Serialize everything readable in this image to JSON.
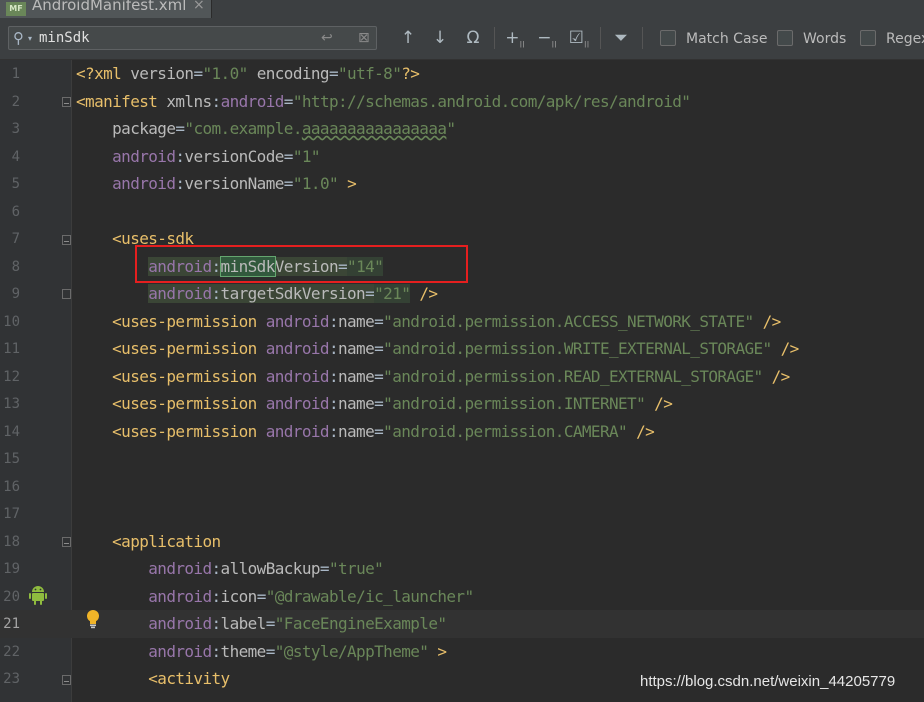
{
  "tab": {
    "icon_text": "MF",
    "label": "AndroidManifest.xml",
    "close": "×"
  },
  "find": {
    "query": "minSdk",
    "options": [
      {
        "label": "Match Case"
      },
      {
        "label": "Words"
      },
      {
        "label": "Regex"
      }
    ]
  },
  "editor": {
    "current_line": 21,
    "line_numbers": [
      "1",
      "2",
      "3",
      "4",
      "5",
      "6",
      "7",
      "8",
      "9",
      "10",
      "11",
      "12",
      "13",
      "14",
      "15",
      "16",
      "17",
      "18",
      "19",
      "20",
      "21",
      "22",
      "23"
    ],
    "lines": [
      [
        [
          "t-tag",
          "<?xml "
        ],
        [
          "t-attr",
          "version"
        ],
        [
          "t-plain",
          "="
        ],
        [
          "t-val",
          "\"1.0\""
        ],
        [
          "t-plain",
          " "
        ],
        [
          "t-attr",
          "encoding"
        ],
        [
          "t-plain",
          "="
        ],
        [
          "t-val",
          "\"utf-8\""
        ],
        [
          "t-tag",
          "?>"
        ]
      ],
      [
        [
          "t-tag",
          "<manifest "
        ],
        [
          "t-attr",
          "xmlns"
        ],
        [
          "t-plain",
          ":"
        ],
        [
          "t-ns",
          "android"
        ],
        [
          "t-plain",
          "="
        ],
        [
          "t-val",
          "\"http://schemas.android.com/apk/res/android\""
        ]
      ],
      [
        [
          "t-plain",
          "    "
        ],
        [
          "t-attr",
          "package"
        ],
        [
          "t-plain",
          "="
        ],
        [
          "t-val",
          "\"com.example."
        ],
        [
          "t-val t-sq",
          "aaaaaaaaaaaaaaaa"
        ],
        [
          "t-val",
          "\""
        ]
      ],
      [
        [
          "t-plain",
          "    "
        ],
        [
          "t-ns",
          "android"
        ],
        [
          "t-plain",
          ":"
        ],
        [
          "t-attr",
          "versionCode"
        ],
        [
          "t-plain",
          "="
        ],
        [
          "t-val",
          "\"1\""
        ]
      ],
      [
        [
          "t-plain",
          "    "
        ],
        [
          "t-ns",
          "android"
        ],
        [
          "t-plain",
          ":"
        ],
        [
          "t-attr",
          "versionName"
        ],
        [
          "t-plain",
          "="
        ],
        [
          "t-val",
          "\"1.0\""
        ],
        [
          "t-plain",
          " "
        ],
        [
          "t-tag",
          ">"
        ]
      ],
      [],
      [
        [
          "t-plain",
          "    "
        ],
        [
          "t-tag",
          "<uses-sdk"
        ]
      ],
      [
        [
          "t-plain",
          "        "
        ],
        [
          "t-ns hl",
          "android"
        ],
        [
          "t-plain hl",
          ":"
        ],
        [
          "t-attr match",
          "minSdk"
        ],
        [
          "t-attr hl",
          "Version"
        ],
        [
          "t-plain hl",
          "="
        ],
        [
          "t-val valbox",
          "\"14\""
        ]
      ],
      [
        [
          "t-plain",
          "        "
        ],
        [
          "t-ns hl",
          "android"
        ],
        [
          "t-plain hl",
          ":"
        ],
        [
          "t-attr hl",
          "targetSdkVersion"
        ],
        [
          "t-plain hl",
          "="
        ],
        [
          "t-val valbox",
          "\"21\""
        ],
        [
          "t-plain",
          " "
        ],
        [
          "t-tag",
          "/>"
        ]
      ],
      [
        [
          "t-plain",
          "    "
        ],
        [
          "t-tag",
          "<uses-permission "
        ],
        [
          "t-ns",
          "android"
        ],
        [
          "t-plain",
          ":"
        ],
        [
          "t-attr",
          "name"
        ],
        [
          "t-plain",
          "="
        ],
        [
          "t-val",
          "\"android.permission.ACCESS_NETWORK_STATE\""
        ],
        [
          "t-plain",
          " "
        ],
        [
          "t-tag",
          "/>"
        ]
      ],
      [
        [
          "t-plain",
          "    "
        ],
        [
          "t-tag",
          "<uses-permission "
        ],
        [
          "t-ns",
          "android"
        ],
        [
          "t-plain",
          ":"
        ],
        [
          "t-attr",
          "name"
        ],
        [
          "t-plain",
          "="
        ],
        [
          "t-val",
          "\"android.permission.WRITE_EXTERNAL_STORAGE\""
        ],
        [
          "t-plain",
          " "
        ],
        [
          "t-tag",
          "/>"
        ]
      ],
      [
        [
          "t-plain",
          "    "
        ],
        [
          "t-tag",
          "<uses-permission "
        ],
        [
          "t-ns",
          "android"
        ],
        [
          "t-plain",
          ":"
        ],
        [
          "t-attr",
          "name"
        ],
        [
          "t-plain",
          "="
        ],
        [
          "t-val",
          "\"android.permission.READ_EXTERNAL_STORAGE\""
        ],
        [
          "t-plain",
          " "
        ],
        [
          "t-tag",
          "/>"
        ]
      ],
      [
        [
          "t-plain",
          "    "
        ],
        [
          "t-tag",
          "<uses-permission "
        ],
        [
          "t-ns",
          "android"
        ],
        [
          "t-plain",
          ":"
        ],
        [
          "t-attr",
          "name"
        ],
        [
          "t-plain",
          "="
        ],
        [
          "t-val",
          "\"android.permission.INTERNET\""
        ],
        [
          "t-plain",
          " "
        ],
        [
          "t-tag",
          "/>"
        ]
      ],
      [
        [
          "t-plain",
          "    "
        ],
        [
          "t-tag",
          "<uses-permission "
        ],
        [
          "t-ns",
          "android"
        ],
        [
          "t-plain",
          ":"
        ],
        [
          "t-attr",
          "name"
        ],
        [
          "t-plain",
          "="
        ],
        [
          "t-val",
          "\"android.permission.CAMERA\""
        ],
        [
          "t-plain",
          " "
        ],
        [
          "t-tag",
          "/>"
        ]
      ],
      [],
      [],
      [],
      [
        [
          "t-plain",
          "    "
        ],
        [
          "t-tag",
          "<application"
        ]
      ],
      [
        [
          "t-plain",
          "        "
        ],
        [
          "t-ns",
          "android"
        ],
        [
          "t-plain",
          ":"
        ],
        [
          "t-attr",
          "allowBackup"
        ],
        [
          "t-plain",
          "="
        ],
        [
          "t-val",
          "\"true\""
        ]
      ],
      [
        [
          "t-plain",
          "        "
        ],
        [
          "t-ns",
          "android"
        ],
        [
          "t-plain",
          ":"
        ],
        [
          "t-attr",
          "icon"
        ],
        [
          "t-plain",
          "="
        ],
        [
          "t-val",
          "\"@drawable/ic_launcher\""
        ]
      ],
      [
        [
          "t-plain",
          "        "
        ],
        [
          "t-ns",
          "android"
        ],
        [
          "t-plain",
          ":"
        ],
        [
          "t-attr",
          "label"
        ],
        [
          "t-plain",
          "="
        ],
        [
          "t-val",
          "\"FaceEngineExample\""
        ]
      ],
      [
        [
          "t-plain",
          "        "
        ],
        [
          "t-ns",
          "android"
        ],
        [
          "t-plain",
          ":"
        ],
        [
          "t-attr",
          "theme"
        ],
        [
          "t-plain",
          "="
        ],
        [
          "t-val",
          "\"@style/AppTheme\""
        ],
        [
          "t-plain",
          " "
        ],
        [
          "t-tag",
          ">"
        ]
      ],
      [
        [
          "t-plain",
          "        "
        ],
        [
          "t-tag",
          "<activity"
        ]
      ]
    ]
  },
  "watermark": "https://blog.csdn.net/weixin_44205779"
}
